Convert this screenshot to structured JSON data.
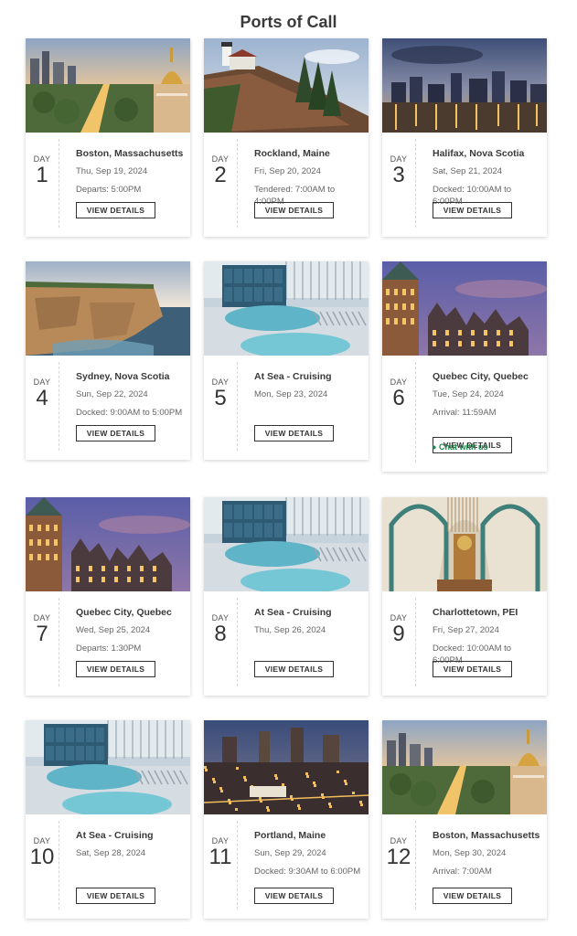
{
  "page": {
    "title": "Ports of Call"
  },
  "labels": {
    "day": "DAY",
    "view_details": "VIEW DETAILS"
  },
  "ports": [
    {
      "day": "1",
      "name": "Boston, Massachusetts",
      "date": "Thu, Sep 19, 2024",
      "extra": "Departs: 5:00PM",
      "image": "boston-skyline"
    },
    {
      "day": "2",
      "name": "Rockland, Maine",
      "date": "Fri, Sep 20, 2024",
      "extra": "Tendered: 7:00AM to 4:00PM",
      "image": "rockland-lighthouse"
    },
    {
      "day": "3",
      "name": "Halifax, Nova Scotia",
      "date": "Sat, Sep 21, 2024",
      "extra": "Docked: 10:00AM to 6:00PM",
      "image": "halifax-night"
    },
    {
      "day": "4",
      "name": "Sydney, Nova Scotia",
      "date": "Sun, Sep 22, 2024",
      "extra": "Docked: 9:00AM to 5:00PM",
      "image": "sydney-cliffs"
    },
    {
      "day": "5",
      "name": "At Sea - Cruising",
      "date": "Mon, Sep 23, 2024",
      "extra": "",
      "image": "ship-pool"
    },
    {
      "day": "6",
      "name": "Quebec City, Quebec",
      "date": "Tue, Sep 24, 2024",
      "extra": "Arrival: 11:59AM",
      "image": "quebec-chateau"
    },
    {
      "day": "7",
      "name": "Quebec City, Quebec",
      "date": "Wed, Sep 25, 2024",
      "extra": "Departs: 1:30PM",
      "image": "quebec-chateau"
    },
    {
      "day": "8",
      "name": "At Sea - Cruising",
      "date": "Thu, Sep 26, 2024",
      "extra": "",
      "image": "ship-pool"
    },
    {
      "day": "9",
      "name": "Charlottetown, PEI",
      "date": "Fri, Sep 27, 2024",
      "extra": "Docked: 10:00AM to 6:00PM",
      "image": "cathedral-interior"
    },
    {
      "day": "10",
      "name": "At Sea - Cruising",
      "date": "Sat, Sep 28, 2024",
      "extra": "",
      "image": "ship-pool"
    },
    {
      "day": "11",
      "name": "Portland, Maine",
      "date": "Sun, Sep 29, 2024",
      "extra": "Docked: 9:30AM to 6:00PM",
      "image": "portland-night"
    },
    {
      "day": "12",
      "name": "Boston, Massachusetts",
      "date": "Mon, Sep 30, 2024",
      "extra": "Arrival: 7:00AM",
      "image": "boston-skyline"
    }
  ],
  "chat_overlay": {
    "text": "Chat with us",
    "icon": "chat-icon"
  }
}
